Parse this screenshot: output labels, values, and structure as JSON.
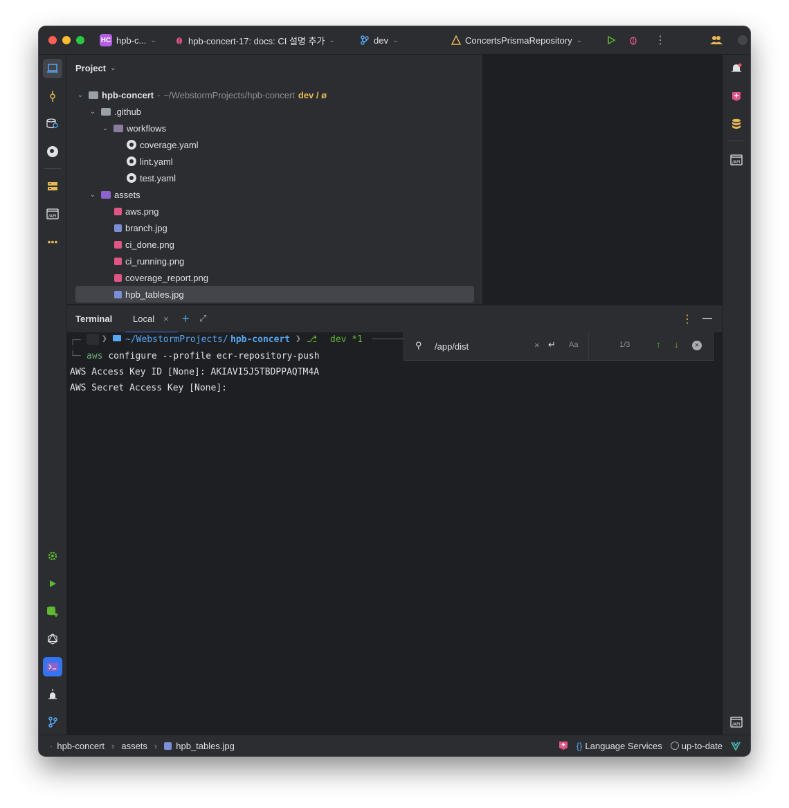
{
  "titlebar": {
    "project_badge": "HC",
    "project_name": "hpb-c...",
    "branch_task": "hpb-concert-17: docs: CI 설명 추가",
    "vcs_branch": "dev",
    "run_config": "ConcertsPrismaRepository"
  },
  "project": {
    "header": "Project",
    "root_name": "hpb-concert",
    "root_path": "~/WebstormProjects/hpb-concert",
    "root_branch": "dev / ø",
    "items": [
      {
        "label": ".github",
        "type": "folder"
      },
      {
        "label": "workflows",
        "type": "folder"
      },
      {
        "label": "coverage.yaml",
        "type": "github"
      },
      {
        "label": "lint.yaml",
        "type": "github"
      },
      {
        "label": "test.yaml",
        "type": "github"
      },
      {
        "label": "assets",
        "type": "folder"
      },
      {
        "label": "aws.png",
        "type": "image"
      },
      {
        "label": "branch.jpg",
        "type": "image"
      },
      {
        "label": "ci_done.png",
        "type": "image"
      },
      {
        "label": "ci_running.png",
        "type": "image"
      },
      {
        "label": "coverage_report.png",
        "type": "image"
      },
      {
        "label": "hpb_tables.jpg",
        "type": "image"
      }
    ]
  },
  "terminal": {
    "title": "Terminal",
    "tab_label": "Local",
    "prompt_path_prefix": "~/WebstormProjects/",
    "prompt_path_dir": "hpb-concert",
    "prompt_branch": "dev *1",
    "command_name": "aws",
    "command_args": "configure --profile ecr-repository-push",
    "output_line1": "AWS Access Key ID [None]: AKIAVI5J5TBDPPAQTM4A",
    "output_line2": "AWS Secret Access Key [None]:",
    "search_query": "/app/dist",
    "search_count": "1/3",
    "case_toggle": "Aa"
  },
  "statusbar": {
    "crumb_root": "hpb-concert",
    "crumb_folder": "assets",
    "crumb_file": "hpb_tables.jpg",
    "language_services": "Language Services",
    "vcs_status": "up-to-date"
  },
  "colors": {
    "accent": "#3574f0",
    "terminal_path": "#56a8f5",
    "terminal_branch": "#5fb832",
    "command_green": "#6aab73",
    "warn_yellow": "#e8b856"
  }
}
